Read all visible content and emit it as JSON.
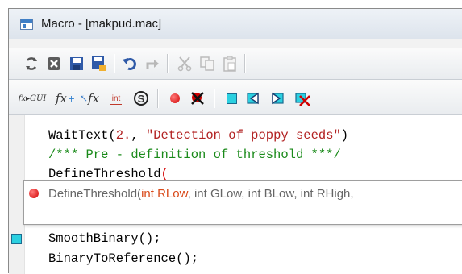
{
  "window": {
    "title": "Macro - [makpud.mac]"
  },
  "toolbar1": {
    "items": [
      {
        "name": "run-macro",
        "glyph": "↻"
      },
      {
        "name": "close",
        "glyph": "✖"
      },
      {
        "name": "save",
        "glyph": "■"
      },
      {
        "name": "save-as",
        "glyph": "▣"
      },
      {
        "name": "undo",
        "glyph": "↶"
      },
      {
        "name": "redo",
        "glyph": "↷"
      },
      {
        "name": "cut",
        "glyph": "✂"
      },
      {
        "name": "copy",
        "glyph": "❐"
      },
      {
        "name": "paste",
        "glyph": "📋"
      }
    ]
  },
  "toolbar2": {
    "fx_gui_label": "fx▸GUI",
    "fx_label": "fx",
    "fx_label2": "fx",
    "int_label": "int",
    "s_label": "S"
  },
  "editor": {
    "lines": [
      {
        "fn": "WaitText",
        "args_open": "(",
        "num": "2.",
        "sep": ", ",
        "str": "\"Detection of poppy seeds\"",
        "close": ")"
      },
      {
        "comment": "/*** Pre - definition of threshold ***/"
      },
      {
        "fn": "DefineThreshold",
        "paren": "("
      },
      {
        "fn": "SmoothBinary",
        "rest": "();"
      },
      {
        "fn": "BinaryToReference",
        "rest": "();"
      }
    ],
    "tooltip": {
      "fn": "DefineThreshold(",
      "p1_type": "int",
      "p1_name": " RLow",
      "rest": ", int GLow, int BLow, int RHigh,"
    }
  },
  "colors": {
    "breakpoint": "#d10000",
    "bookmark": "#2bd0e0",
    "comment": "#1a8a1a",
    "string": "#b22222"
  }
}
